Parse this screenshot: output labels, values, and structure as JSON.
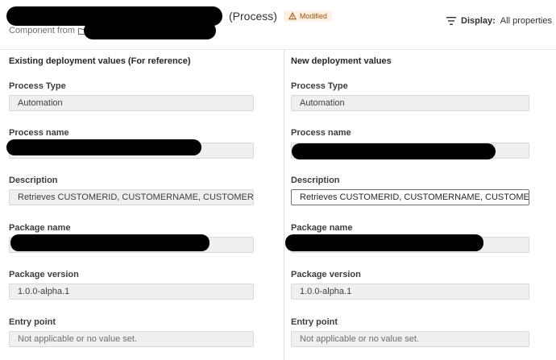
{
  "header": {
    "title_suffix": "(Process)",
    "badge": "Modified",
    "subtitle_prefix": "Component from",
    "display_label": "Display:",
    "display_value": "All properties"
  },
  "left": {
    "title": "Existing deployment values (For reference)",
    "fields": [
      {
        "label": "Process Type",
        "value": "Automation"
      },
      {
        "label": "Process name",
        "value": ""
      },
      {
        "label": "Description",
        "value": "Retrieves CUSTOMERID, CUSTOMERNAME, CUSTOMERACC..."
      },
      {
        "label": "Package name",
        "value": ""
      },
      {
        "label": "Package version",
        "value": "1.0.0-alpha.1"
      },
      {
        "label": "Entry point",
        "value": "Not applicable or no value set."
      }
    ]
  },
  "right": {
    "title": "New deployment values",
    "fields": [
      {
        "label": "Process Type",
        "value": "Automation"
      },
      {
        "label": "Process name",
        "value": ""
      },
      {
        "label": "Description",
        "value": "Retrieves CUSTOMERID, CUSTOMERNAME, CUSTOMERAC..."
      },
      {
        "label": "Package name",
        "value": ""
      },
      {
        "label": "Package version",
        "value": "1.0.0-alpha.1"
      },
      {
        "label": "Entry point",
        "value": "Not applicable or no value set."
      }
    ]
  },
  "icons": {
    "badge": "warning-triangle-icon",
    "folder": "folder-icon",
    "display": "filter-lines-icon"
  }
}
